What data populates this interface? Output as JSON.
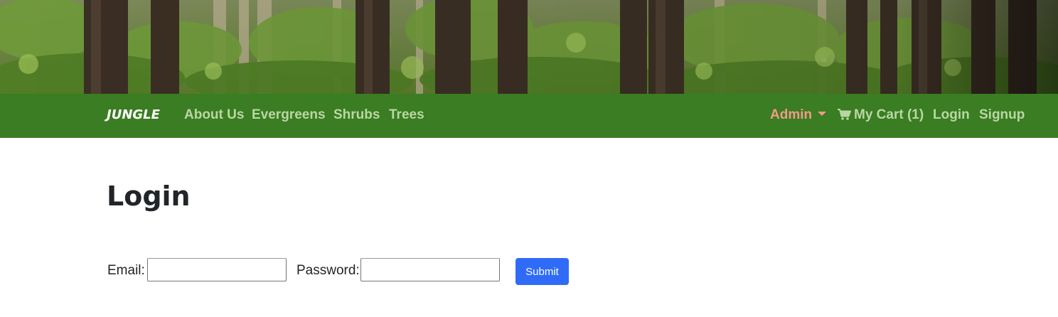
{
  "header": {
    "banner_image": "forest-banner",
    "brand": "JUNGLE",
    "nav_left": [
      {
        "label": "About Us"
      },
      {
        "label": "Evergreens"
      },
      {
        "label": "Shrubs"
      },
      {
        "label": "Trees"
      }
    ],
    "nav_right": {
      "admin": "Admin",
      "cart": "My Cart (1)",
      "cart_icon": "cart-icon",
      "login": "Login",
      "signup": "Signup"
    }
  },
  "main": {
    "title": "Login",
    "form": {
      "email_label": "Email:",
      "email_value": "",
      "password_label": "Password:",
      "password_value": "",
      "submit_label": "Submit"
    }
  },
  "colors": {
    "navbar": "#3a7d22",
    "nav_link": "#b9d7a4",
    "admin_link": "#f29a8a",
    "submit_button": "#2f6bf6"
  }
}
